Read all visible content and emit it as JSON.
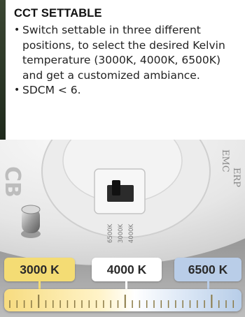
{
  "panel": {
    "title": "CCT SETTABLE",
    "bullet_symbol": "•",
    "bullets": [
      "Switch settable in three different positions, to select the desired Kelvin temperature (3000K, 4000K, 6500K) and get a customized ambiance.",
      "SDCM < 6."
    ]
  },
  "device": {
    "switch_labels": [
      "6500K",
      "3000K",
      "4000K"
    ],
    "side_markings": [
      "EMC",
      "ERP"
    ],
    "left_marking": "CB"
  },
  "temperatures": [
    {
      "label": "3000 K",
      "color": "#f4dc74"
    },
    {
      "label": "4000 K",
      "color": "#ffffff"
    },
    {
      "label": "6500 K",
      "color": "#b9cde8"
    }
  ],
  "colors": {
    "warm": "#f4dc74",
    "neutral": "#ffffff",
    "cool": "#b9cde8"
  }
}
